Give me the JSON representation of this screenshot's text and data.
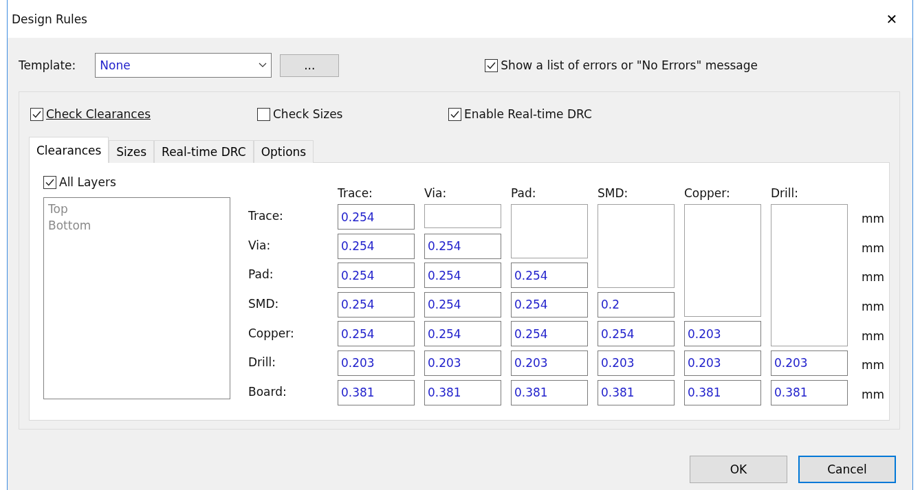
{
  "window": {
    "title": "Design Rules",
    "close": "✕"
  },
  "template": {
    "label": "Template:",
    "value": "None",
    "browse": "..."
  },
  "show_errors": {
    "label": "Show a list of errors or \"No Errors\" message",
    "checked": true
  },
  "checks": [
    {
      "label": "Check Clearances",
      "checked": true,
      "focused": true
    },
    {
      "label": "Check Sizes",
      "checked": false,
      "focused": false
    },
    {
      "label": "Enable Real-time DRC",
      "checked": true,
      "focused": false
    }
  ],
  "tabs": [
    {
      "label": "Clearances",
      "selected": true
    },
    {
      "label": "Sizes",
      "selected": false
    },
    {
      "label": "Real-time DRC",
      "selected": false
    },
    {
      "label": "Options",
      "selected": false
    }
  ],
  "all_layers": {
    "label": "All Layers",
    "checked": true
  },
  "layers": [
    {
      "label": "Top",
      "disabled": true
    },
    {
      "label": "Bottom",
      "disabled": true
    }
  ],
  "columns": [
    "Trace:",
    "Via:",
    "Pad:",
    "SMD:",
    "Copper:",
    "Drill:"
  ],
  "rows": [
    {
      "label": "Trace:",
      "unit": "mm",
      "values": [
        "0.254"
      ]
    },
    {
      "label": "Via:",
      "unit": "mm",
      "values": [
        "0.254",
        "0.254"
      ]
    },
    {
      "label": "Pad:",
      "unit": "mm",
      "values": [
        "0.254",
        "0.254",
        "0.254"
      ]
    },
    {
      "label": "SMD:",
      "unit": "mm",
      "values": [
        "0.254",
        "0.254",
        "0.254",
        "0.2"
      ]
    },
    {
      "label": "Copper:",
      "unit": "mm",
      "values": [
        "0.254",
        "0.254",
        "0.254",
        "0.254",
        "0.203"
      ]
    },
    {
      "label": "Drill:",
      "unit": "mm",
      "values": [
        "0.203",
        "0.203",
        "0.203",
        "0.203",
        "0.203",
        "0.203"
      ]
    },
    {
      "label": "Board:",
      "unit": "mm",
      "values": [
        "0.381",
        "0.381",
        "0.381",
        "0.381",
        "0.381",
        "0.381"
      ]
    }
  ],
  "buttons": [
    {
      "label": "OK",
      "default": false
    },
    {
      "label": "Cancel",
      "default": true
    }
  ]
}
